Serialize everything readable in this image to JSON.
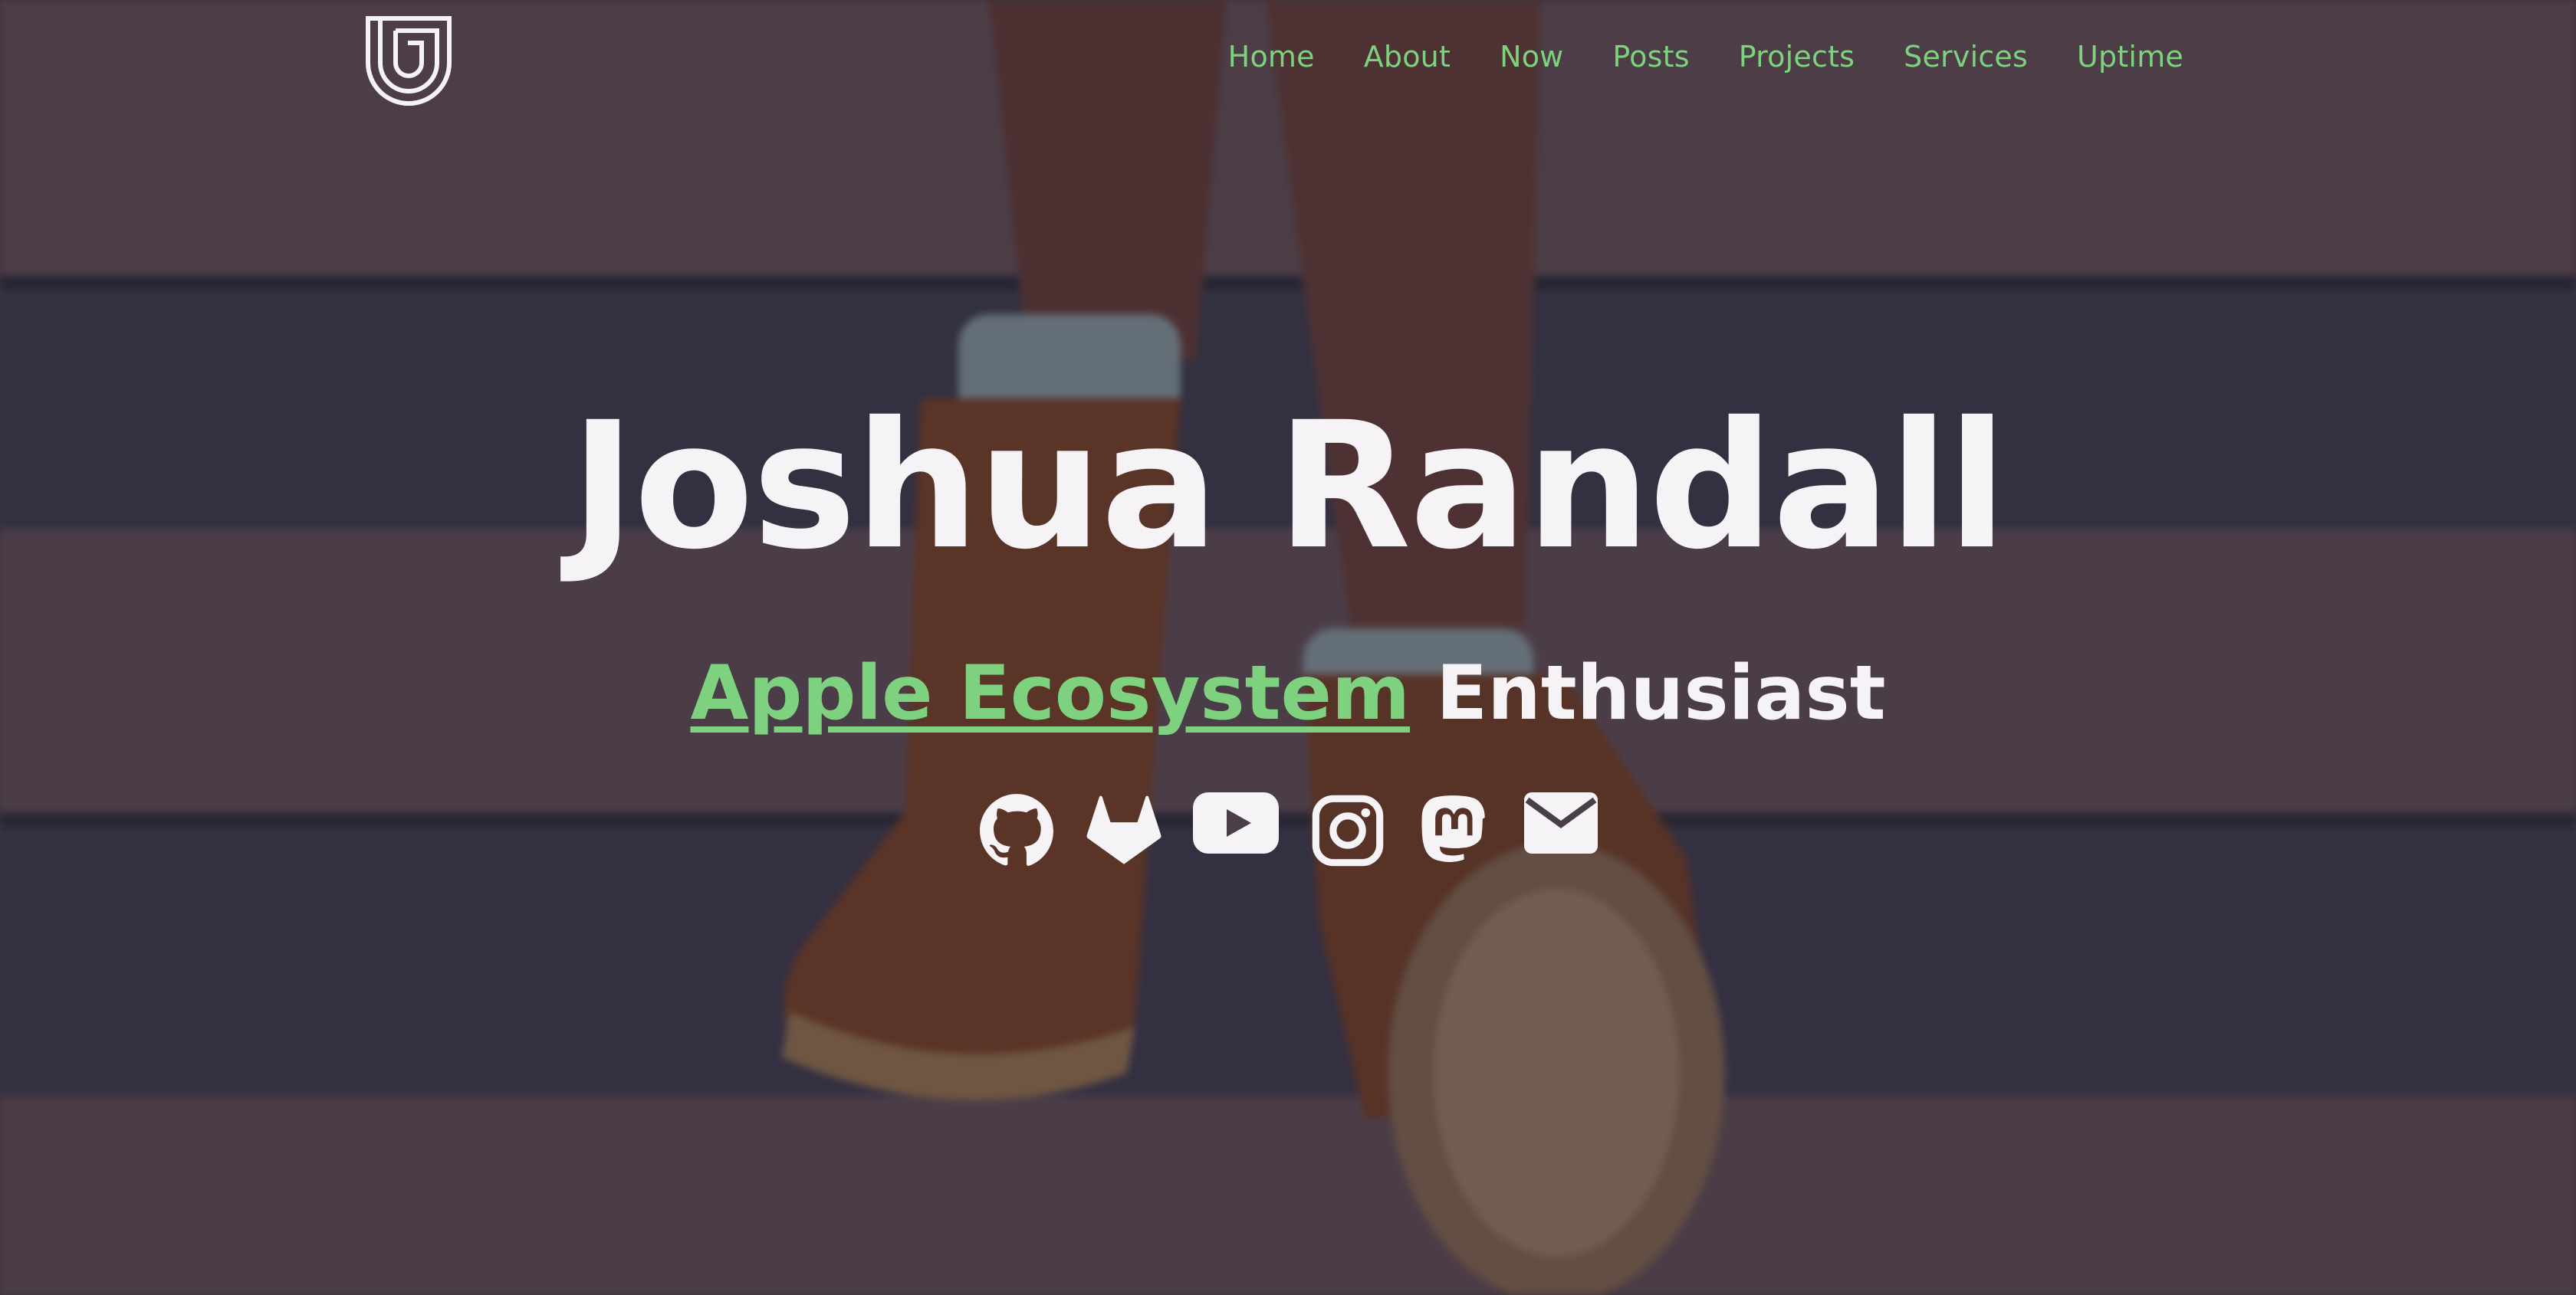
{
  "site": {
    "logo_icon": "monogram-j-icon"
  },
  "nav": {
    "items": [
      {
        "label": "Home"
      },
      {
        "label": "About"
      },
      {
        "label": "Now"
      },
      {
        "label": "Posts"
      },
      {
        "label": "Projects"
      },
      {
        "label": "Services"
      },
      {
        "label": "Uptime"
      }
    ]
  },
  "hero": {
    "name": "Joshua Randall",
    "tagline_highlight": "Apple Ecosystem",
    "tagline_rest": "Enthusiast"
  },
  "socials": [
    {
      "icon": "github-icon"
    },
    {
      "icon": "gitlab-icon"
    },
    {
      "icon": "youtube-icon"
    },
    {
      "icon": "instagram-icon"
    },
    {
      "icon": "mastodon-icon"
    },
    {
      "icon": "email-icon"
    }
  ],
  "colors": {
    "accent": "#7ed17e",
    "text": "#f5f3f5",
    "background": "#4a3f48"
  }
}
